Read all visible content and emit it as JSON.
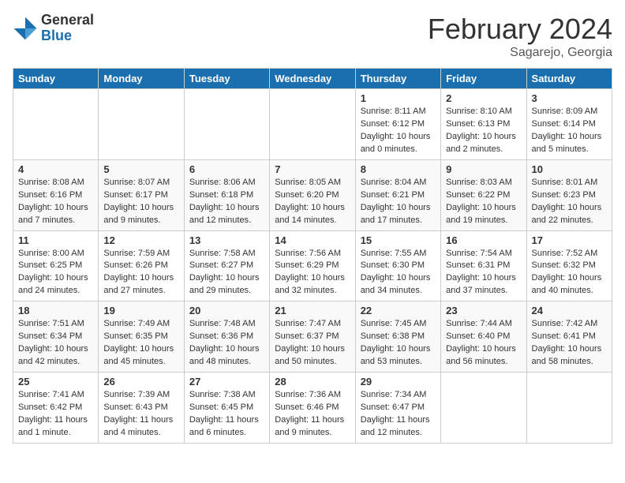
{
  "header": {
    "logo_general": "General",
    "logo_blue": "Blue",
    "month_title": "February 2024",
    "location": "Sagarejo, Georgia"
  },
  "days_of_week": [
    "Sunday",
    "Monday",
    "Tuesday",
    "Wednesday",
    "Thursday",
    "Friday",
    "Saturday"
  ],
  "weeks": [
    [
      {
        "day": "",
        "info": ""
      },
      {
        "day": "",
        "info": ""
      },
      {
        "day": "",
        "info": ""
      },
      {
        "day": "",
        "info": ""
      },
      {
        "day": "1",
        "info": "Sunrise: 8:11 AM\nSunset: 6:12 PM\nDaylight: 10 hours\nand 0 minutes."
      },
      {
        "day": "2",
        "info": "Sunrise: 8:10 AM\nSunset: 6:13 PM\nDaylight: 10 hours\nand 2 minutes."
      },
      {
        "day": "3",
        "info": "Sunrise: 8:09 AM\nSunset: 6:14 PM\nDaylight: 10 hours\nand 5 minutes."
      }
    ],
    [
      {
        "day": "4",
        "info": "Sunrise: 8:08 AM\nSunset: 6:16 PM\nDaylight: 10 hours\nand 7 minutes."
      },
      {
        "day": "5",
        "info": "Sunrise: 8:07 AM\nSunset: 6:17 PM\nDaylight: 10 hours\nand 9 minutes."
      },
      {
        "day": "6",
        "info": "Sunrise: 8:06 AM\nSunset: 6:18 PM\nDaylight: 10 hours\nand 12 minutes."
      },
      {
        "day": "7",
        "info": "Sunrise: 8:05 AM\nSunset: 6:20 PM\nDaylight: 10 hours\nand 14 minutes."
      },
      {
        "day": "8",
        "info": "Sunrise: 8:04 AM\nSunset: 6:21 PM\nDaylight: 10 hours\nand 17 minutes."
      },
      {
        "day": "9",
        "info": "Sunrise: 8:03 AM\nSunset: 6:22 PM\nDaylight: 10 hours\nand 19 minutes."
      },
      {
        "day": "10",
        "info": "Sunrise: 8:01 AM\nSunset: 6:23 PM\nDaylight: 10 hours\nand 22 minutes."
      }
    ],
    [
      {
        "day": "11",
        "info": "Sunrise: 8:00 AM\nSunset: 6:25 PM\nDaylight: 10 hours\nand 24 minutes."
      },
      {
        "day": "12",
        "info": "Sunrise: 7:59 AM\nSunset: 6:26 PM\nDaylight: 10 hours\nand 27 minutes."
      },
      {
        "day": "13",
        "info": "Sunrise: 7:58 AM\nSunset: 6:27 PM\nDaylight: 10 hours\nand 29 minutes."
      },
      {
        "day": "14",
        "info": "Sunrise: 7:56 AM\nSunset: 6:29 PM\nDaylight: 10 hours\nand 32 minutes."
      },
      {
        "day": "15",
        "info": "Sunrise: 7:55 AM\nSunset: 6:30 PM\nDaylight: 10 hours\nand 34 minutes."
      },
      {
        "day": "16",
        "info": "Sunrise: 7:54 AM\nSunset: 6:31 PM\nDaylight: 10 hours\nand 37 minutes."
      },
      {
        "day": "17",
        "info": "Sunrise: 7:52 AM\nSunset: 6:32 PM\nDaylight: 10 hours\nand 40 minutes."
      }
    ],
    [
      {
        "day": "18",
        "info": "Sunrise: 7:51 AM\nSunset: 6:34 PM\nDaylight: 10 hours\nand 42 minutes."
      },
      {
        "day": "19",
        "info": "Sunrise: 7:49 AM\nSunset: 6:35 PM\nDaylight: 10 hours\nand 45 minutes."
      },
      {
        "day": "20",
        "info": "Sunrise: 7:48 AM\nSunset: 6:36 PM\nDaylight: 10 hours\nand 48 minutes."
      },
      {
        "day": "21",
        "info": "Sunrise: 7:47 AM\nSunset: 6:37 PM\nDaylight: 10 hours\nand 50 minutes."
      },
      {
        "day": "22",
        "info": "Sunrise: 7:45 AM\nSunset: 6:38 PM\nDaylight: 10 hours\nand 53 minutes."
      },
      {
        "day": "23",
        "info": "Sunrise: 7:44 AM\nSunset: 6:40 PM\nDaylight: 10 hours\nand 56 minutes."
      },
      {
        "day": "24",
        "info": "Sunrise: 7:42 AM\nSunset: 6:41 PM\nDaylight: 10 hours\nand 58 minutes."
      }
    ],
    [
      {
        "day": "25",
        "info": "Sunrise: 7:41 AM\nSunset: 6:42 PM\nDaylight: 11 hours\nand 1 minute."
      },
      {
        "day": "26",
        "info": "Sunrise: 7:39 AM\nSunset: 6:43 PM\nDaylight: 11 hours\nand 4 minutes."
      },
      {
        "day": "27",
        "info": "Sunrise: 7:38 AM\nSunset: 6:45 PM\nDaylight: 11 hours\nand 6 minutes."
      },
      {
        "day": "28",
        "info": "Sunrise: 7:36 AM\nSunset: 6:46 PM\nDaylight: 11 hours\nand 9 minutes."
      },
      {
        "day": "29",
        "info": "Sunrise: 7:34 AM\nSunset: 6:47 PM\nDaylight: 11 hours\nand 12 minutes."
      },
      {
        "day": "",
        "info": ""
      },
      {
        "day": "",
        "info": ""
      }
    ]
  ]
}
